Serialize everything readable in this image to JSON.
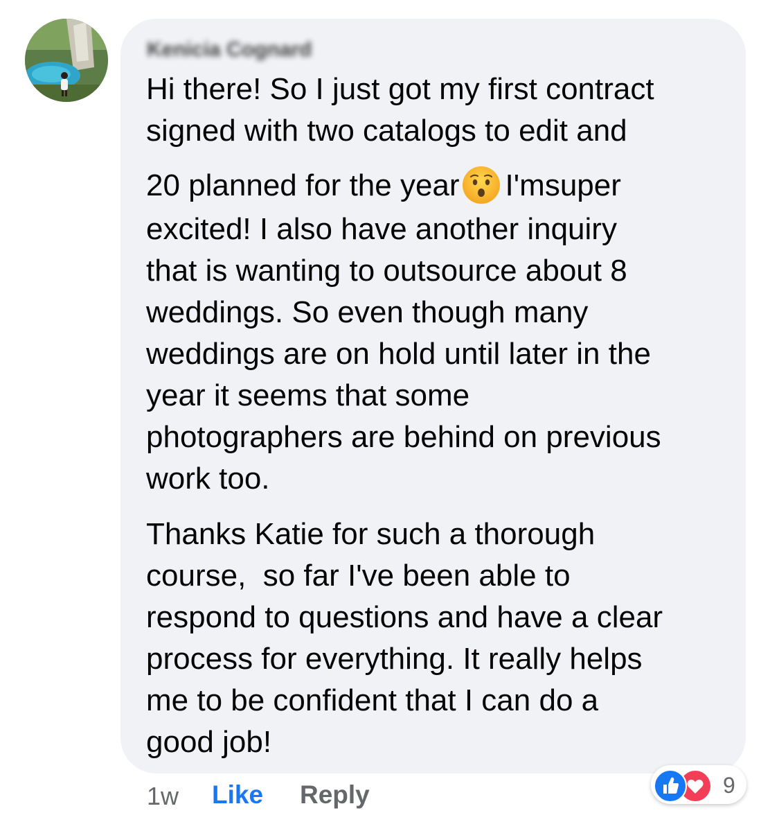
{
  "comment": {
    "author": "Kenicia Cognard",
    "lines_p1": [
      "Hi there! So I just got my first contract",
      "signed with two catalogs to edit and",
      "20 planned for the year",
      "excited! I also have another inquiry",
      "that is wanting to outsource about 8",
      "weddings. So even though many",
      "weddings are on hold until later in the",
      "year it seems that some",
      "photographers are behind on previous",
      "work too."
    ],
    "line3_after_emoji": "I'msuper",
    "lines_p2": [
      "Thanks Katie for such a thorough",
      "course,  so far I've been able to",
      "respond to questions and have a clear",
      "process for everything. It really helps",
      "me to be confident that I can do a",
      "good job!"
    ],
    "emoji": "hushed-face-emoji"
  },
  "actions": {
    "time": "1w",
    "like_label": "Like",
    "reply_label": "Reply"
  },
  "reactions": {
    "icons": [
      "thumbs-up-icon",
      "heart-icon"
    ],
    "count": "9"
  },
  "colors": {
    "bubble": "#f0f2f5",
    "like_blue": "#1877f2",
    "love_red": "#f33e58",
    "muted": "#65676b"
  }
}
